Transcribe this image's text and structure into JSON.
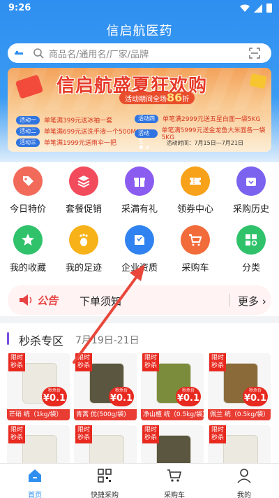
{
  "status_bar": {
    "time": "9:26"
  },
  "app": {
    "title": "信启航医药"
  },
  "search": {
    "placeholder": "商品名/通用名/厂家/品牌"
  },
  "banner": {
    "title": "信启航盛夏狂欢购",
    "subtitle_prefix": "活动期间全场",
    "discount": "86",
    "subtitle_suffix": "折",
    "activities": [
      {
        "tag": "活动一",
        "text": "单笔满399元送冰袖一套"
      },
      {
        "tag": "活动二",
        "text": "单笔满699元送洗手液一个500ML"
      },
      {
        "tag": "活动三",
        "text": "单笔满1999元送雨伞一把"
      },
      {
        "tag": "活动四",
        "text": "单笔满2999元送五星白面一袋5KG"
      },
      {
        "tag": "活动五",
        "text": "单笔满5999元送金龙鱼大米面各一袋5KG"
      }
    ],
    "time_text": "活动时间：7月15日—7月21日"
  },
  "menu": [
    {
      "label": "今日特价",
      "icon": "tag-icon",
      "color": "#f26b5a"
    },
    {
      "label": "套餐促销",
      "icon": "layers-icon",
      "color": "#f24b5c"
    },
    {
      "label": "采满有礼",
      "icon": "gift-icon",
      "color": "#8b5cf0"
    },
    {
      "label": "领券中心",
      "icon": "coupon-icon",
      "color": "#f7a21a"
    },
    {
      "label": "采购历史",
      "icon": "bag-icon",
      "color": "#7b63f0"
    },
    {
      "label": "我的收藏",
      "icon": "star-icon",
      "color": "#2fc26a"
    },
    {
      "label": "我的足迹",
      "icon": "footprint-icon",
      "color": "#f7b21a"
    },
    {
      "label": "企业资质",
      "icon": "certificate-icon",
      "color": "#2f82f0"
    },
    {
      "label": "采购车",
      "icon": "cart-icon",
      "color": "#f26b3a"
    },
    {
      "label": "分类",
      "icon": "grid-icon",
      "color": "#2fc26a"
    }
  ],
  "notice": {
    "badge": "公告",
    "text": "下单须知",
    "more": "更多"
  },
  "flash_sale": {
    "title": "秒杀专区",
    "date": "7月19日-21日",
    "seal": "限时秒杀",
    "price_label": "秒杀价",
    "products": [
      {
        "name": "芒硝 统（1kg/袋）",
        "price": "¥0.1"
      },
      {
        "name": "青蒿 优(500g/袋)",
        "price": "¥0.1"
      },
      {
        "name": "净山楂 统（0.5kg/袋）",
        "price": "¥0.1"
      },
      {
        "name": "佩兰 统（0.5kg/袋）",
        "price": "¥0.1"
      }
    ]
  },
  "tabbar": [
    {
      "label": "首页",
      "icon": "home-icon"
    },
    {
      "label": "快捷采购",
      "icon": "qrcode-icon"
    },
    {
      "label": "采购车",
      "icon": "cart-icon"
    },
    {
      "label": "我的",
      "icon": "user-icon"
    }
  ],
  "colors": {
    "primary": "#2f8ff0",
    "accent_red": "#e8291f",
    "notice_bg": "#fff3f3"
  }
}
